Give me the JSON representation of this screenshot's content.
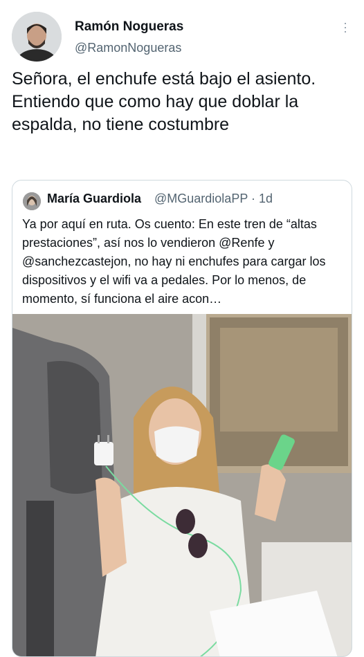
{
  "author": {
    "name": "Ramón Nogueras",
    "handle": "@RamonNogueras"
  },
  "tweet": {
    "text": "Señora, el enchufe está bajo el asiento. Entiendo que como hay que doblar la espalda, no tiene costumbre"
  },
  "quoted": {
    "name": "María Guardiola",
    "handle_time": "@MGuardiolaPP · 1d",
    "text": "Ya por aquí en ruta. Os cuento: En este tren de “altas prestaciones”, así nos lo vendieron @Renfe y @sanchezcastejon, no hay ni enchufes para cargar los dispositivos y el wifi va a pedales. Por lo menos, de momento, sí funciona el aire acon…"
  },
  "icons": {
    "more": "more-vertical-icon"
  },
  "colors": {
    "text": "#0f1419",
    "secondary": "#536471",
    "border": "#cfd9de"
  }
}
